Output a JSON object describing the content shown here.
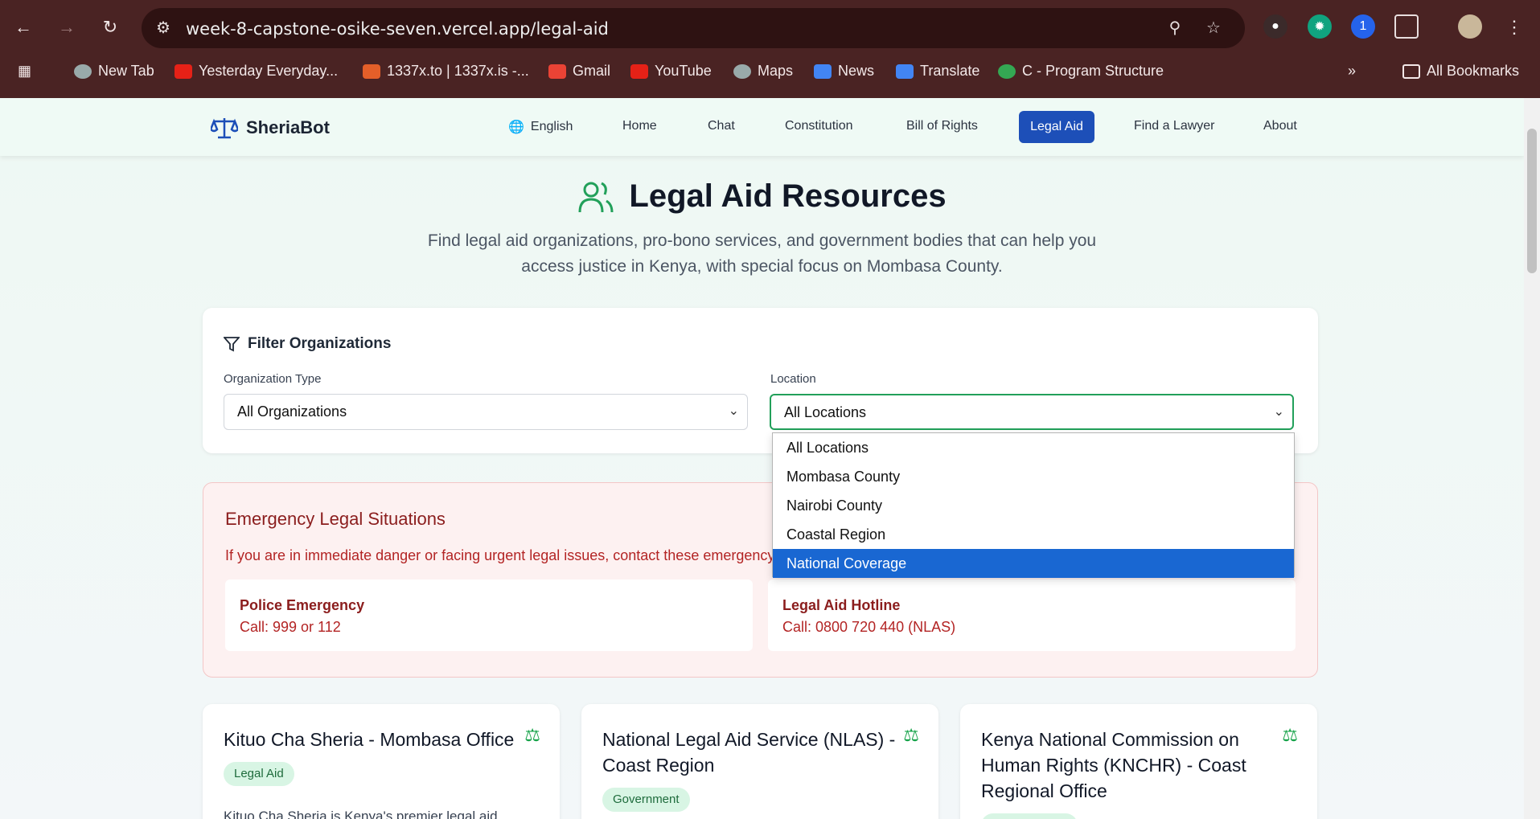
{
  "browser": {
    "url": "week-8-capstone-osike-seven.vercel.app/legal-aid",
    "bookmarks": [
      "New Tab",
      "Yesterday Everyday...",
      "1337x.to | 1337x.is -...",
      "Gmail",
      "YouTube",
      "Maps",
      "News",
      "Translate",
      "C - Program Structure"
    ],
    "all_bookmarks": "All Bookmarks",
    "ext_badge": "1"
  },
  "nav": {
    "brand": "SheriaBot",
    "language": "English",
    "links": [
      "Home",
      "Chat",
      "Constitution",
      "Bill of Rights",
      "Legal Aid",
      "Find a Lawyer",
      "About"
    ]
  },
  "hero": {
    "title": "Legal Aid Resources",
    "subtitle": "Find legal aid organizations, pro-bono services, and government bodies that can help you access justice in Kenya, with special focus on Mombasa County."
  },
  "filter": {
    "title": "Filter Organizations",
    "type_label": "Organization Type",
    "type_value": "All Organizations",
    "location_label": "Location",
    "location_value": "All Locations",
    "location_options": [
      "All Locations",
      "Mombasa County",
      "Nairobi County",
      "Coastal Region",
      "National Coverage"
    ]
  },
  "emergency": {
    "title": "Emergency Legal Situations",
    "text": "If you are in immediate danger or facing urgent legal issues, contact these emergency",
    "police_title": "Police Emergency",
    "police_value": "Call: 999 or 112",
    "hotline_title": "Legal Aid Hotline",
    "hotline_value": "Call: 0800 720 440 (NLAS)"
  },
  "orgs": [
    {
      "name": "Kituo Cha Sheria - Mombasa Office",
      "tag": "Legal Aid",
      "desc": "Kituo Cha Sheria is Kenya's premier legal aid"
    },
    {
      "name": "National Legal Aid Service (NLAS) - Coast Region",
      "tag": "Government"
    },
    {
      "name": "Kenya National Commission on Human Rights (KNCHR) - Coast Regional Office"
    }
  ]
}
